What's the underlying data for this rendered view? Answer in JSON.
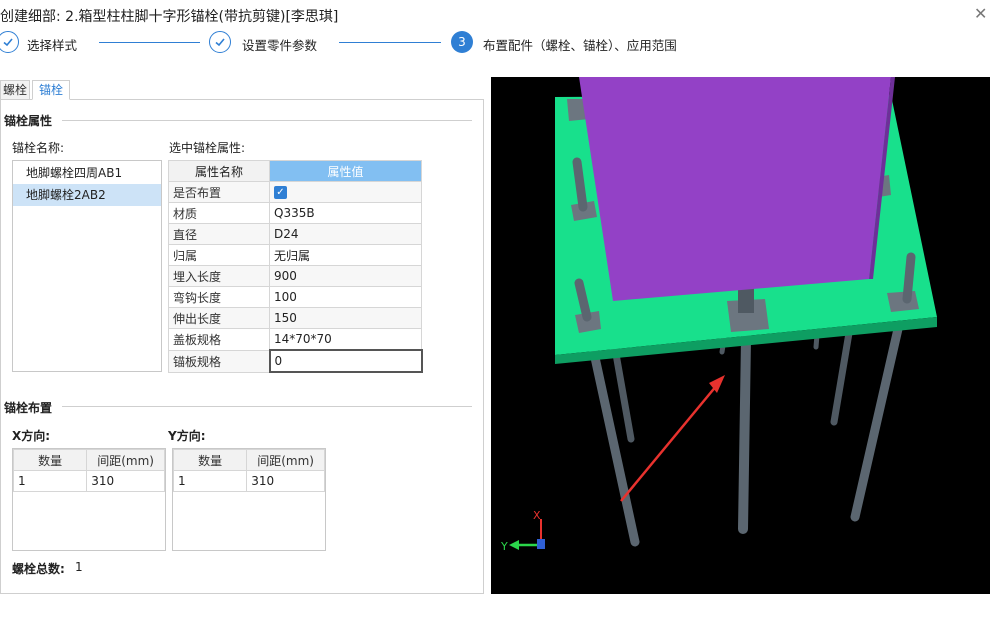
{
  "window": {
    "title": "创建细部: 2.箱型柱柱脚十字形锚栓(带抗剪键)[李思琪]",
    "close_glyph": "✕"
  },
  "steps": [
    {
      "label": "选择样式",
      "state": "done"
    },
    {
      "label": "设置零件参数",
      "state": "done"
    },
    {
      "number": "3",
      "label": "布置配件（螺栓、锚栓）、应用范围",
      "state": "current"
    }
  ],
  "tabs": [
    {
      "label": "螺栓",
      "active": false
    },
    {
      "label": "锚栓",
      "active": true
    }
  ],
  "anchor_props": {
    "section_title": "锚栓属性",
    "list_label": "锚栓名称:",
    "items": [
      "地脚螺栓四周AB1",
      "地脚螺栓2AB2"
    ],
    "selected_index": 1,
    "props_label": "选中锚栓属性:",
    "header": {
      "name": "属性名称",
      "value": "属性值"
    },
    "rows": [
      {
        "name": "是否布置",
        "value": "",
        "checked": true
      },
      {
        "name": "材质",
        "value": "Q335B"
      },
      {
        "name": "直径",
        "value": "D24"
      },
      {
        "name": "归属",
        "value": "无归属"
      },
      {
        "name": "埋入长度",
        "value": "900"
      },
      {
        "name": "弯钩长度",
        "value": "100"
      },
      {
        "name": "伸出长度",
        "value": "150"
      },
      {
        "name": "盖板规格",
        "value": "14*70*70"
      },
      {
        "name": "锚板规格",
        "value": "0"
      }
    ]
  },
  "layout_section": {
    "section_title": "锚栓布置",
    "x_label": "X方向:",
    "y_label": "Y方向:",
    "headers": {
      "count": "数量",
      "spacing": "间距(mm)"
    },
    "x_rows": [
      {
        "count": "1",
        "spacing": "310"
      }
    ],
    "y_rows": [
      {
        "count": "1",
        "spacing": "310"
      }
    ],
    "total_label": "螺栓总数:",
    "total_value": "1"
  },
  "viewport": {
    "axis_x": "X",
    "axis_y": "Y",
    "colors": {
      "background": "#000000",
      "column": "#9341c6",
      "plate": "#18e08c",
      "bolt": "#5b6670",
      "arrow": "#e8322e"
    }
  }
}
